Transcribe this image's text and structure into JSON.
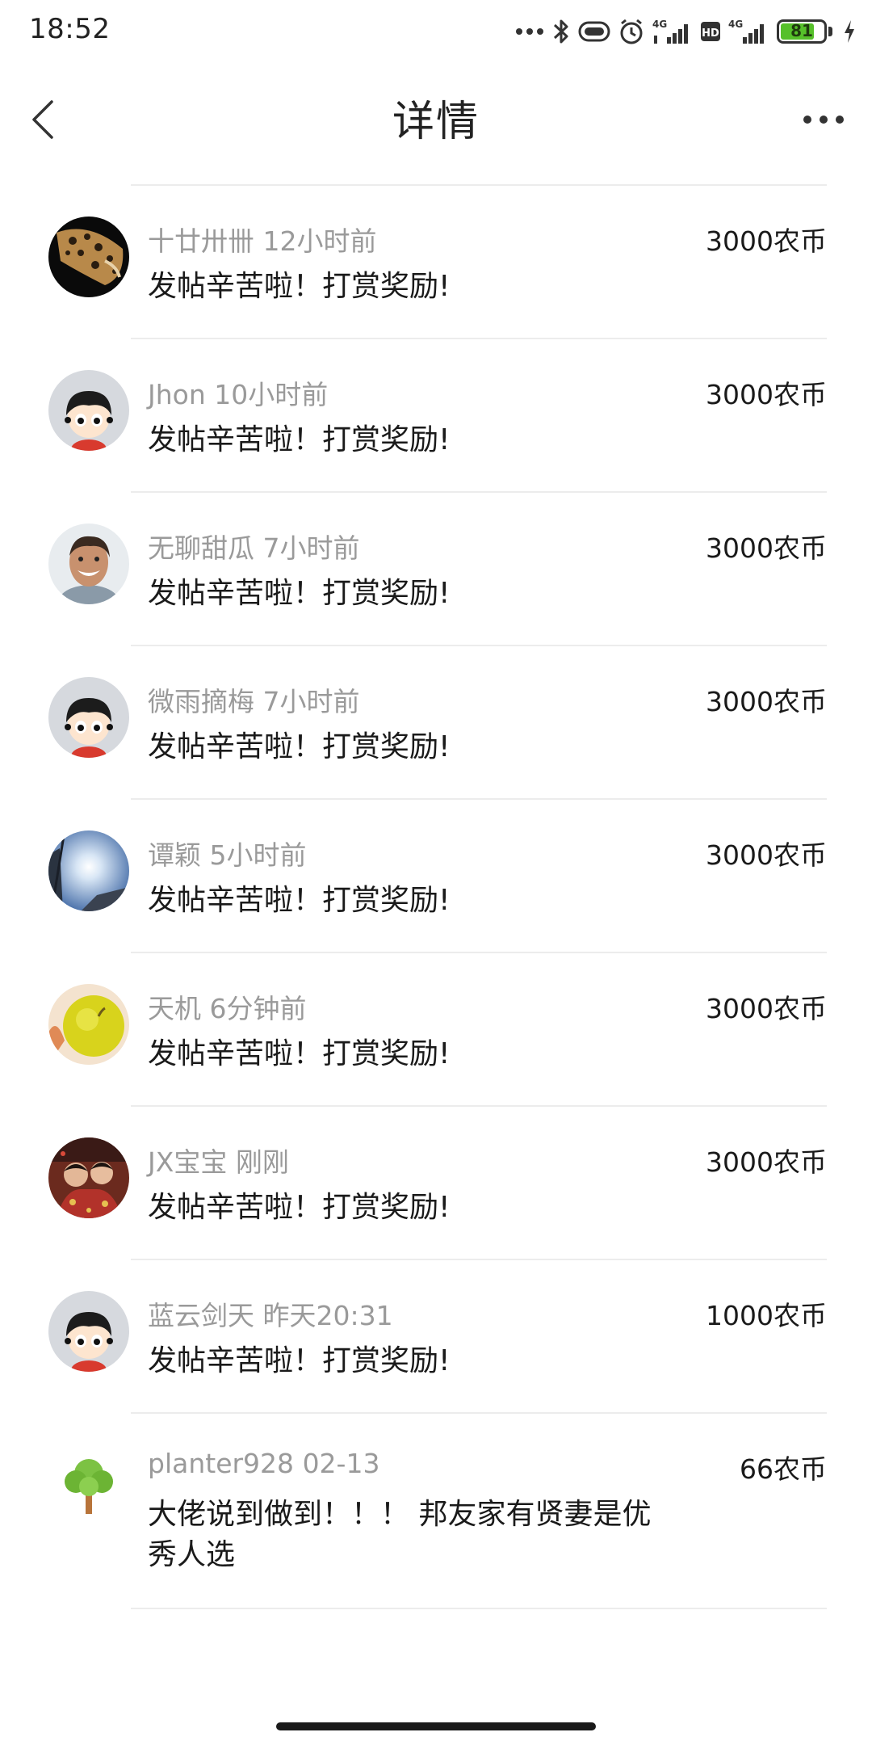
{
  "status_bar": {
    "time": "18:52",
    "battery": "81",
    "battery_level": 0.81,
    "network_1": "4G",
    "network_2": "4G",
    "hd": "HD"
  },
  "nav": {
    "title": "详情"
  },
  "rewards": [
    {
      "name": "十廿卅卌",
      "time": "12小时前",
      "amount": "3000农币",
      "message": "发帖辛苦啦！打赏奖励!",
      "avatar": "leopard"
    },
    {
      "name": "Jhon",
      "time": "10小时前",
      "amount": "3000农币",
      "message": "发帖辛苦啦！打赏奖励!",
      "avatar": "cartoon-default"
    },
    {
      "name": "无聊甜瓜",
      "time": "7小时前",
      "amount": "3000农币",
      "message": "发帖辛苦啦！打赏奖励!",
      "avatar": "smiling-man"
    },
    {
      "name": "微雨摘梅",
      "time": "7小时前",
      "amount": "3000农币",
      "message": "发帖辛苦啦！打赏奖励!",
      "avatar": "cartoon-default"
    },
    {
      "name": "谭颖",
      "time": "5小时前",
      "amount": "3000农币",
      "message": "发帖辛苦啦！打赏奖励!",
      "avatar": "sky-sun"
    },
    {
      "name": "天机",
      "time": "6分钟前",
      "amount": "3000农币",
      "message": "发帖辛苦啦！打赏奖励!",
      "avatar": "yellow-fruit"
    },
    {
      "name": "JX宝宝",
      "time": "刚刚",
      "amount": "3000农币",
      "message": "发帖辛苦啦！打赏奖励!",
      "avatar": "children-photo"
    },
    {
      "name": "蓝云剑天",
      "time": "昨天20:31",
      "amount": "1000农币",
      "message": "发帖辛苦啦！打赏奖励!",
      "avatar": "cartoon-default"
    },
    {
      "name": "planter928",
      "time": "02-13",
      "amount": "66农币",
      "message": "大佬说到做到！！！ 邦友家有贤妻是优秀人选",
      "avatar": "tree"
    }
  ]
}
